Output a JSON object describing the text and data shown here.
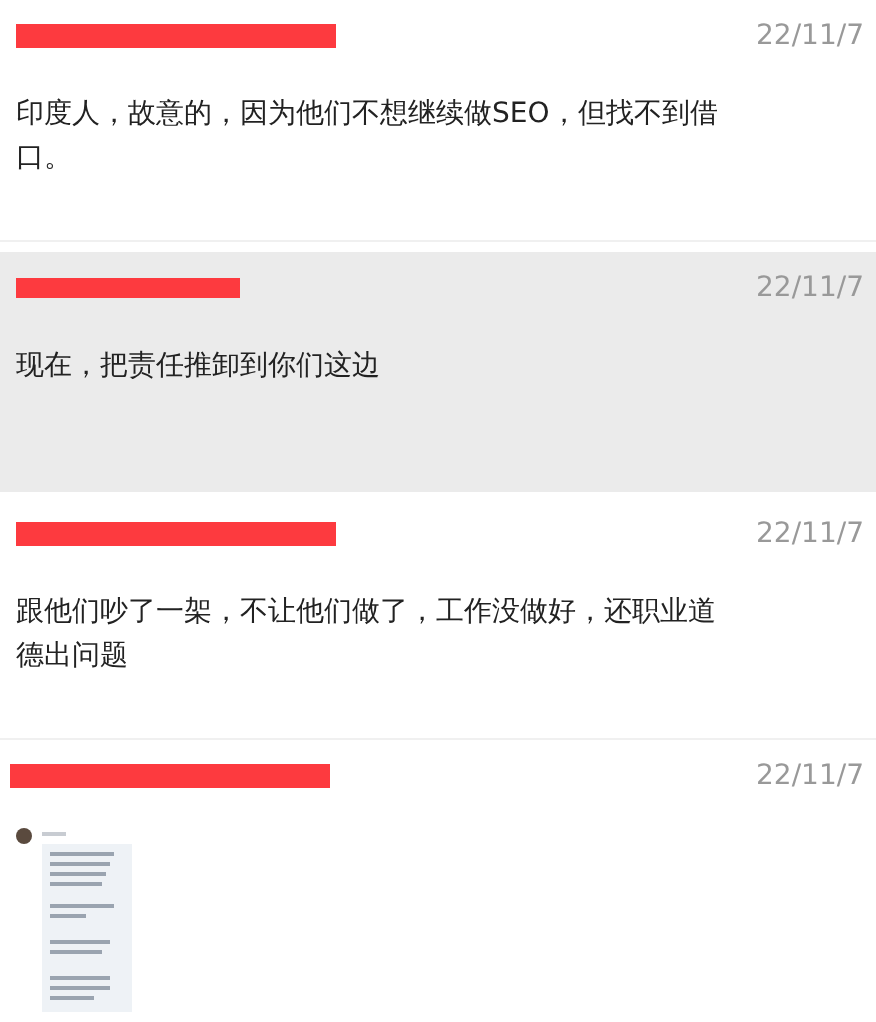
{
  "comments": [
    {
      "highlighted": false,
      "date": "22/11/7",
      "text": "印度人，故意的，因为他们不想继续做SEO，但找不到借口。"
    },
    {
      "highlighted": true,
      "date": "22/11/7",
      "text": "现在，把责任推卸到你们这边"
    },
    {
      "highlighted": false,
      "date": "22/11/7",
      "text": "跟他们吵了一架，不让他们做了，工作没做好，还职业道德出问题"
    },
    {
      "highlighted": false,
      "date": "22/11/7"
    }
  ]
}
